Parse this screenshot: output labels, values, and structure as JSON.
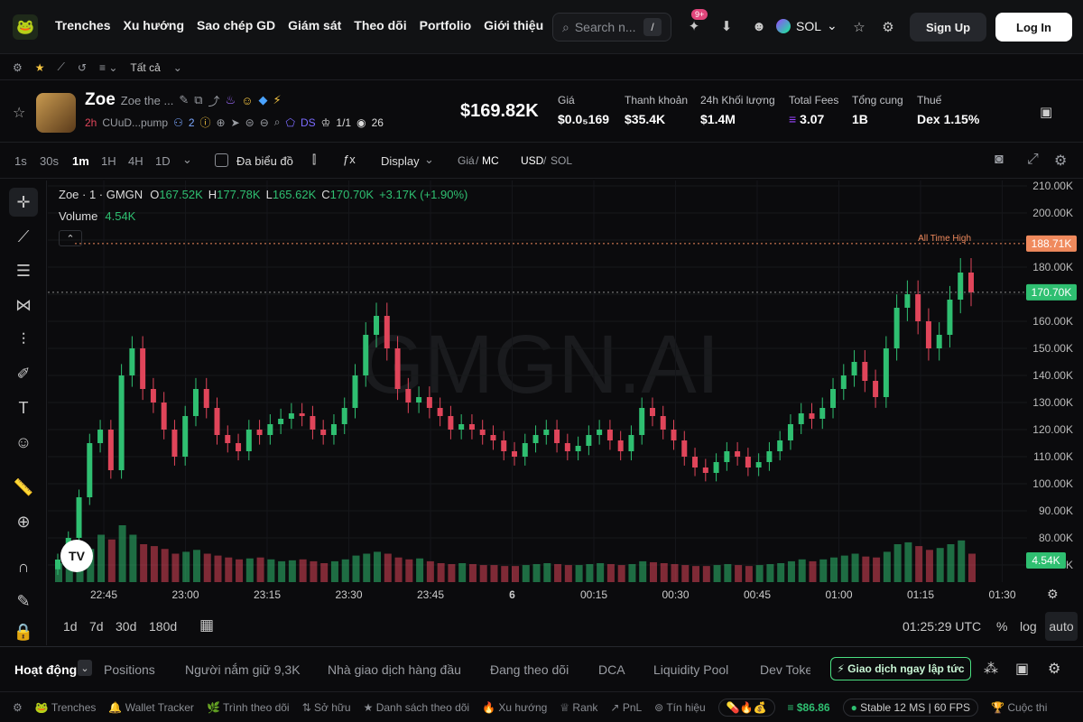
{
  "nav": {
    "logo": "🐸",
    "links": [
      "Trenches",
      "Xu hướng",
      "Sao chép GD",
      "Giám sát",
      "Theo dõi",
      "Portfolio",
      "Giới thiệu"
    ],
    "search_placeholder": "Search n...",
    "search_shortcut": "/",
    "notif_badge": "9+",
    "chain": "SOL",
    "signup": "Sign Up",
    "login": "Log In"
  },
  "subnav": {
    "filter": "Tất cả"
  },
  "token": {
    "symbol": "Zoe",
    "fullname": "Zoe the ...",
    "age": "2h",
    "address": "CUuD...pump",
    "holders_icon_count": "2",
    "ds": "DS",
    "ratio": "1/1",
    "views": "26",
    "price": "$169.82K",
    "stats": [
      {
        "label": "Giá",
        "value": "$0.0₅169"
      },
      {
        "label": "Thanh khoản",
        "value": "$35.4K"
      },
      {
        "label": "24h Khối lượng",
        "value": "$1.4M"
      },
      {
        "label": "Total Fees",
        "value": "3.07"
      },
      {
        "label": "Tổng cung",
        "value": "1B"
      },
      {
        "label": "Thuế",
        "value": "Dex 1.15%"
      }
    ]
  },
  "toolbar": {
    "intervals": [
      "1s",
      "30s",
      "1m",
      "1H",
      "4H",
      "1D"
    ],
    "active_interval": "1m",
    "multi_chart": "Đa biểu đồ",
    "display": "Display",
    "price_mc_a": "Giá",
    "price_mc_b": "MC",
    "usd_sol_a": "USD",
    "usd_sol_b": "SOL"
  },
  "chart_data": {
    "type": "candlestick",
    "title": "Zoe · 1 · GMGN",
    "watermark": "GMGN.AI",
    "ohlc_text": {
      "o": "167.52K",
      "h": "177.78K",
      "l": "165.62K",
      "c": "170.70K",
      "chg": "+3.17K (+1.90%)"
    },
    "volume_label": "Volume",
    "volume_value": "4.54K",
    "ath_label": "All Time High",
    "ath_value": "188.71K",
    "last_value": "170.70K",
    "y_ticks": [
      "210.00K",
      "200.00K",
      "190.00K",
      "180.00K",
      "170.00K",
      "160.00K",
      "150.00K",
      "140.00K",
      "130.00K",
      "120.00K",
      "110.00K",
      "100.00K",
      "90.00K",
      "80.00K",
      "70.00K"
    ],
    "ylim": [
      68000,
      212000
    ],
    "x_ticks": [
      "22:45",
      "23:00",
      "23:15",
      "23:30",
      "23:45",
      "6",
      "00:15",
      "00:30",
      "00:45",
      "01:00",
      "01:15",
      "01:30"
    ],
    "close_series": [
      72000,
      80000,
      95000,
      115000,
      120000,
      105000,
      140000,
      150000,
      135000,
      130000,
      120000,
      110000,
      125000,
      135000,
      128000,
      118000,
      115000,
      112000,
      120000,
      118000,
      122000,
      124000,
      126000,
      125000,
      120000,
      118000,
      122000,
      128000,
      140000,
      155000,
      162000,
      150000,
      135000,
      130000,
      132000,
      128000,
      125000,
      120000,
      122000,
      120000,
      118000,
      116000,
      112000,
      110000,
      115000,
      118000,
      120000,
      115000,
      112000,
      114000,
      118000,
      120000,
      116000,
      112000,
      118000,
      128000,
      125000,
      120000,
      116000,
      110000,
      106000,
      104000,
      108000,
      112000,
      110000,
      106000,
      108000,
      112000,
      116000,
      122000,
      126000,
      124000,
      128000,
      135000,
      140000,
      145000,
      138000,
      132000,
      150000,
      165000,
      170000,
      160000,
      150000,
      155000,
      168000,
      178000,
      170700
    ],
    "volume_series": [
      20,
      30,
      40,
      35,
      50,
      45,
      60,
      50,
      40,
      38,
      35,
      30,
      32,
      34,
      30,
      28,
      26,
      24,
      25,
      26,
      24,
      22,
      23,
      24,
      22,
      20,
      22,
      24,
      28,
      30,
      32,
      30,
      26,
      24,
      25,
      22,
      20,
      19,
      20,
      19,
      18,
      18,
      17,
      17,
      18,
      19,
      20,
      19,
      18,
      18,
      19,
      20,
      19,
      18,
      19,
      22,
      21,
      20,
      19,
      18,
      17,
      17,
      18,
      19,
      18,
      17,
      18,
      19,
      20,
      22,
      24,
      22,
      24,
      26,
      28,
      30,
      27,
      26,
      32,
      40,
      42,
      38,
      34,
      36,
      40,
      44,
      30
    ],
    "time_range_buttons": [
      "1d",
      "7d",
      "30d",
      "180d"
    ],
    "clock": "01:25:29 UTC",
    "scale_pct": "%",
    "scale_log": "log",
    "scale_auto": "auto"
  },
  "tabs": [
    "Hoạt động",
    "Positions",
    "Người nắm giữ 9,3K",
    "Nhà giao dịch hàng đầu",
    "Đang theo dõi",
    "DCA",
    "Liquidity Pool",
    "Dev Toke"
  ],
  "cta": "⚡ Giao dịch ngay lập tức",
  "footer": {
    "items": [
      "Trenches",
      "Wallet Tracker",
      "Trình theo dõi",
      "Sở hữu",
      "Danh sách theo dõi",
      "Xu hướng",
      "Rank",
      "PnL",
      "Tín hiệu"
    ],
    "sol_price": "$86.86",
    "status": "Stable",
    "latency": "12 MS",
    "fps": "60 FPS",
    "contest": "Cuộc thi"
  },
  "colors": {
    "up": "#2fbf71",
    "down": "#e0455a",
    "ath": "#f08a5d"
  }
}
